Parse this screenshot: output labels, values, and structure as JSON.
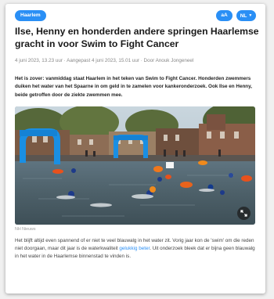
{
  "colors": {
    "accent": "#2a8ff5",
    "link": "#2a8ff5",
    "background": "#f0f0f0",
    "card": "#ffffff"
  },
  "header": {
    "category_label": "Haarlem",
    "text_size_label": "aA",
    "language_label": "NL",
    "language_icon": "chevron-down-icon"
  },
  "article": {
    "title": "Ilse, Henny en honderden andere springen Haarlemse gracht in voor Swim to Fight Cancer",
    "meta": "4 juni 2023, 13.23 uur · Aangepast 4 juni 2023, 15.01 uur · Door Anouk Jongeneel",
    "lead": "Het is zover: vanmiddag staat Haarlem in het teken van Swim to Fight Cancer. Honderden zwemmers duiken het water van het Spaarne in om geld in te zamelen voor kankeronderzoek. Ook Ilse en Henny, beide getroffen door de ziekte zwemmen mee.",
    "image_credit": "NH Nieuws",
    "expand_icon": "expand-icon",
    "body_before_link": "Het blijft altijd even spannend of er niet te veel blauwalg in het water zit. Vorig jaar kon de 'swim' om die reden niet doorgaan, maar dit jaar is de waterkwaliteit ",
    "body_link": "gelukkig beter",
    "body_after_link": ". Uit onderzoek bleek dat er bijna geen blauwalg in het water in de Haarlemse binnenstad te vinden is."
  }
}
